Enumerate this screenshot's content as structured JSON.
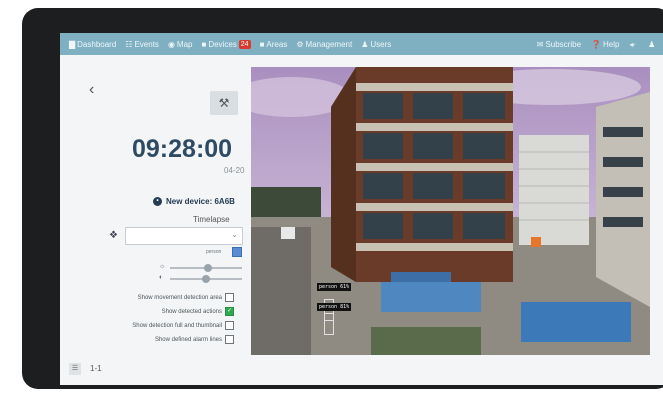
{
  "nav": {
    "items": [
      {
        "icon": "chart-icon",
        "glyph": "▇",
        "label": "Dashboard"
      },
      {
        "icon": "events-icon",
        "glyph": "☷",
        "label": "Events"
      },
      {
        "icon": "map-pin-icon",
        "glyph": "◉",
        "label": "Map"
      },
      {
        "icon": "folder-icon",
        "glyph": "■",
        "label": "Devices",
        "badge": "24"
      },
      {
        "icon": "areas-icon",
        "glyph": "■",
        "label": "Areas"
      },
      {
        "icon": "gear-icon",
        "glyph": "⚙",
        "label": "Management"
      },
      {
        "icon": "users-icon",
        "glyph": "♟",
        "label": "Users"
      }
    ],
    "right": [
      {
        "icon": "envelope-icon",
        "glyph": "✉",
        "label": "Subscribe"
      },
      {
        "icon": "help-icon",
        "glyph": "❓",
        "label": "Help"
      },
      {
        "icon": "volume-icon",
        "glyph": "◂·",
        "label": ""
      },
      {
        "icon": "user-icon",
        "glyph": "♟",
        "label": ""
      },
      {
        "icon": "logout-icon",
        "glyph": "⇥",
        "label": ""
      }
    ]
  },
  "panel": {
    "time": "09:28:00",
    "date": "04-20",
    "device_name": "New device: 6A6B",
    "mode": "Timelapse",
    "person_label": "person",
    "options": [
      {
        "label": "Show movement detection area",
        "checked": false
      },
      {
        "label": "Show detected actions",
        "checked": true
      },
      {
        "label": "Show detection full and thumbnail",
        "checked": false
      },
      {
        "label": "Show defined alarm lines",
        "checked": false
      }
    ]
  },
  "footer": {
    "pages": "1-1"
  },
  "video": {
    "detections": [
      "person 61%",
      "person 81%"
    ]
  },
  "colors": {
    "nav": "#7fb0c2",
    "title": "#2e4b63",
    "checked": "#2fa84f"
  }
}
